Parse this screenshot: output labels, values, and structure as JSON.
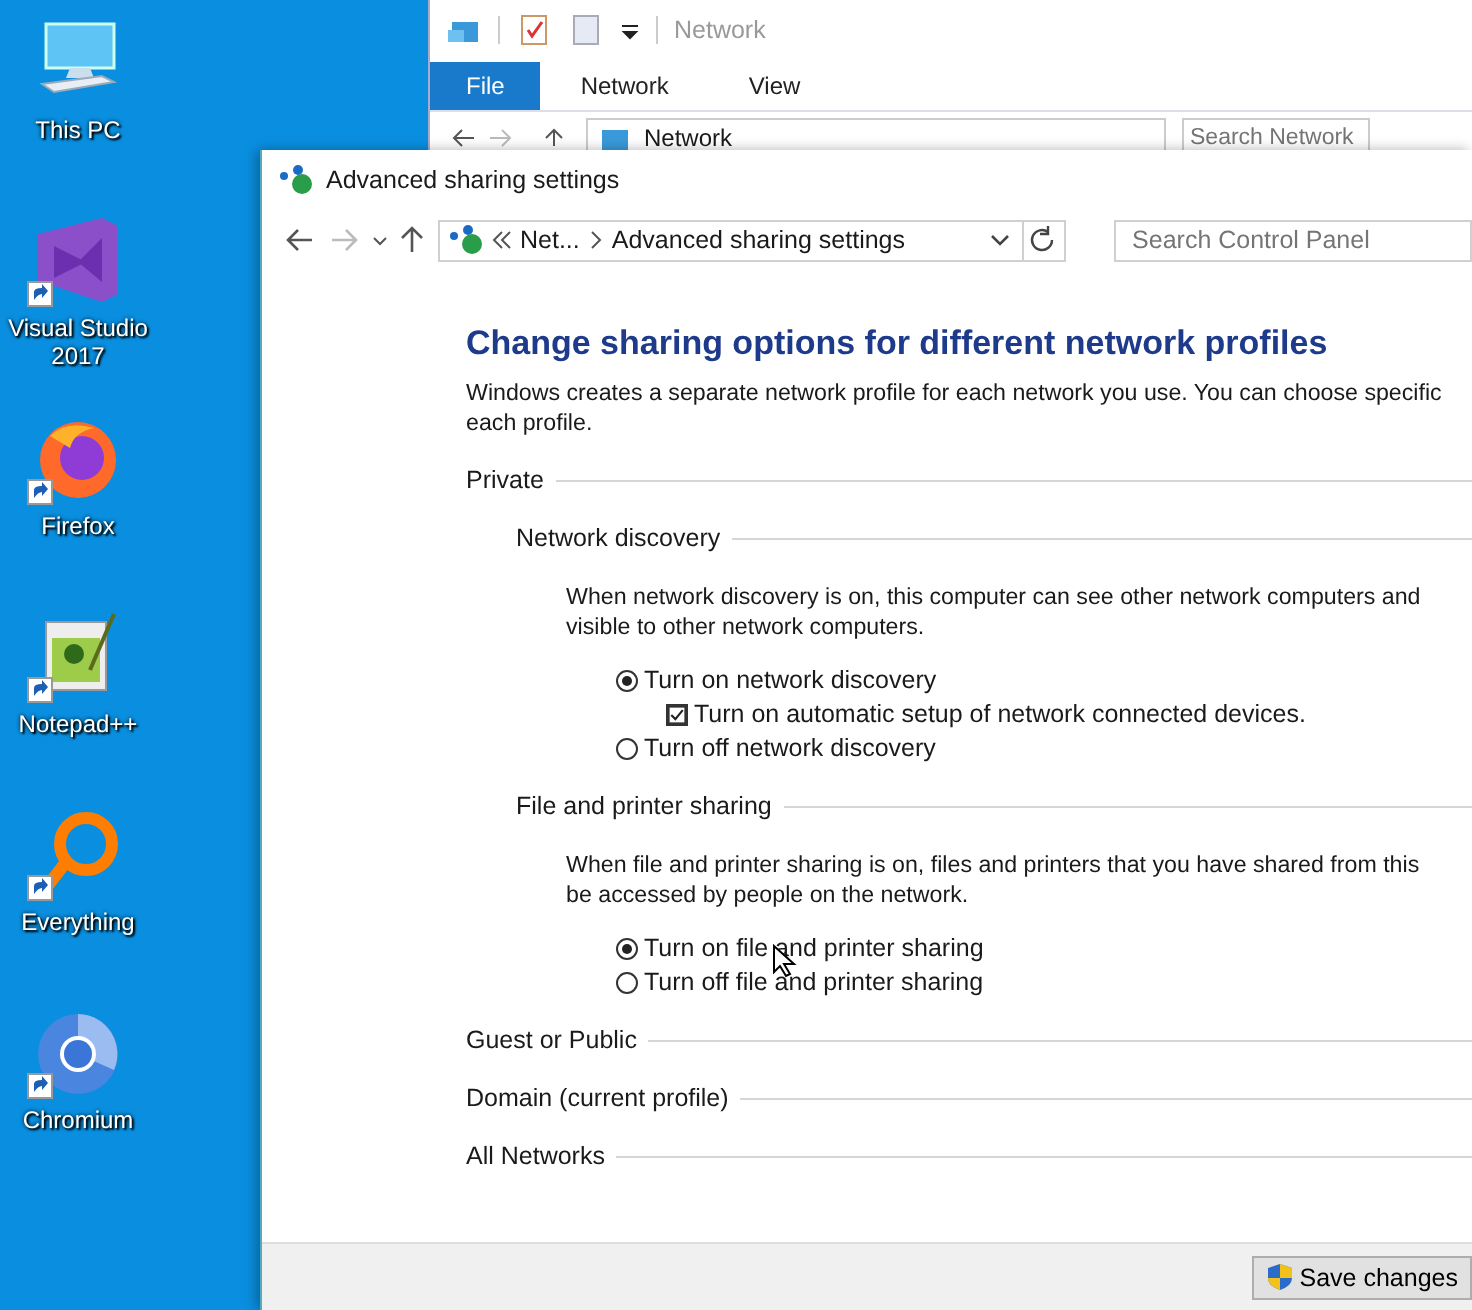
{
  "desktop": {
    "icons": [
      {
        "label": "This PC",
        "kind": "pc",
        "shortcut": false
      },
      {
        "label": "Visual Studio 2017",
        "kind": "vs",
        "shortcut": true
      },
      {
        "label": "Firefox",
        "kind": "firefox",
        "shortcut": true
      },
      {
        "label": "Notepad++",
        "kind": "notepad",
        "shortcut": true
      },
      {
        "label": "Everything",
        "kind": "everything",
        "shortcut": true
      },
      {
        "label": "Chromium",
        "kind": "chromium",
        "shortcut": true
      }
    ]
  },
  "explorer": {
    "title": "Network",
    "tabs": [
      {
        "label": "File",
        "selected": true
      },
      {
        "label": "Network",
        "selected": false
      },
      {
        "label": "View",
        "selected": false
      }
    ],
    "address": "Network",
    "search": {
      "placeholder": "Search Network"
    }
  },
  "dialog": {
    "title": "Advanced sharing settings",
    "breadcrumb": [
      "Net...",
      "Advanced sharing settings"
    ],
    "search": {
      "placeholder": "Search Control Panel"
    },
    "heading": "Change sharing options for different network profiles",
    "description": [
      "Windows creates a separate network profile for each network you use. You can choose specific",
      "each profile."
    ],
    "sections": [
      {
        "label": "Private",
        "groups": [
          {
            "label": "Network discovery",
            "description": [
              "When network discovery is on, this computer can see other network computers and",
              "visible to other network computers."
            ],
            "options": [
              {
                "kind": "radio",
                "label": "Turn on network discovery",
                "selected": true
              },
              {
                "kind": "checkbox",
                "label": "Turn on automatic setup of network connected devices.",
                "checked": true
              },
              {
                "kind": "radio",
                "label": "Turn off network discovery",
                "selected": false
              }
            ]
          },
          {
            "label": "File and printer sharing",
            "description": [
              "When file and printer sharing is on, files and printers that you have shared from this",
              "be accessed by people on the network."
            ],
            "options": [
              {
                "kind": "radio",
                "label": "Turn on file and printer sharing",
                "selected": true
              },
              {
                "kind": "radio",
                "label": "Turn off file and printer sharing",
                "selected": false
              }
            ]
          }
        ]
      },
      {
        "label": "Guest or Public"
      },
      {
        "label": "Domain (current profile)"
      },
      {
        "label": "All Networks"
      }
    ],
    "save_button": "Save changes"
  }
}
